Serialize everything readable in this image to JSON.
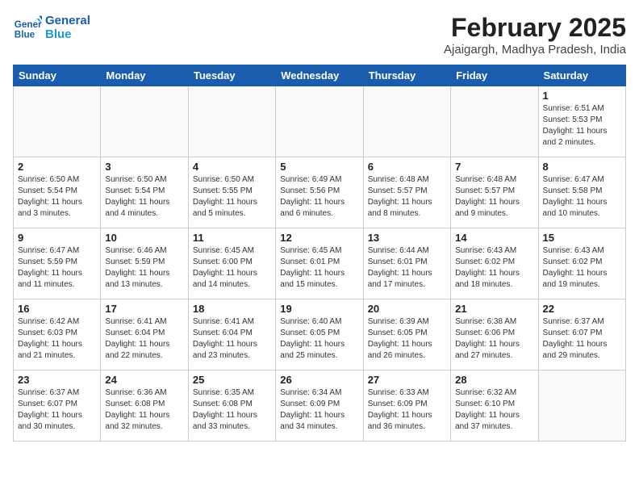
{
  "header": {
    "logo_line1": "General",
    "logo_line2": "Blue",
    "month": "February 2025",
    "location": "Ajaigargh, Madhya Pradesh, India"
  },
  "weekdays": [
    "Sunday",
    "Monday",
    "Tuesday",
    "Wednesday",
    "Thursday",
    "Friday",
    "Saturday"
  ],
  "weeks": [
    [
      {
        "day": "",
        "info": ""
      },
      {
        "day": "",
        "info": ""
      },
      {
        "day": "",
        "info": ""
      },
      {
        "day": "",
        "info": ""
      },
      {
        "day": "",
        "info": ""
      },
      {
        "day": "",
        "info": ""
      },
      {
        "day": "1",
        "info": "Sunrise: 6:51 AM\nSunset: 5:53 PM\nDaylight: 11 hours\nand 2 minutes."
      }
    ],
    [
      {
        "day": "2",
        "info": "Sunrise: 6:50 AM\nSunset: 5:54 PM\nDaylight: 11 hours\nand 3 minutes."
      },
      {
        "day": "3",
        "info": "Sunrise: 6:50 AM\nSunset: 5:54 PM\nDaylight: 11 hours\nand 4 minutes."
      },
      {
        "day": "4",
        "info": "Sunrise: 6:50 AM\nSunset: 5:55 PM\nDaylight: 11 hours\nand 5 minutes."
      },
      {
        "day": "5",
        "info": "Sunrise: 6:49 AM\nSunset: 5:56 PM\nDaylight: 11 hours\nand 6 minutes."
      },
      {
        "day": "6",
        "info": "Sunrise: 6:48 AM\nSunset: 5:57 PM\nDaylight: 11 hours\nand 8 minutes."
      },
      {
        "day": "7",
        "info": "Sunrise: 6:48 AM\nSunset: 5:57 PM\nDaylight: 11 hours\nand 9 minutes."
      },
      {
        "day": "8",
        "info": "Sunrise: 6:47 AM\nSunset: 5:58 PM\nDaylight: 11 hours\nand 10 minutes."
      }
    ],
    [
      {
        "day": "9",
        "info": "Sunrise: 6:47 AM\nSunset: 5:59 PM\nDaylight: 11 hours\nand 11 minutes."
      },
      {
        "day": "10",
        "info": "Sunrise: 6:46 AM\nSunset: 5:59 PM\nDaylight: 11 hours\nand 13 minutes."
      },
      {
        "day": "11",
        "info": "Sunrise: 6:45 AM\nSunset: 6:00 PM\nDaylight: 11 hours\nand 14 minutes."
      },
      {
        "day": "12",
        "info": "Sunrise: 6:45 AM\nSunset: 6:01 PM\nDaylight: 11 hours\nand 15 minutes."
      },
      {
        "day": "13",
        "info": "Sunrise: 6:44 AM\nSunset: 6:01 PM\nDaylight: 11 hours\nand 17 minutes."
      },
      {
        "day": "14",
        "info": "Sunrise: 6:43 AM\nSunset: 6:02 PM\nDaylight: 11 hours\nand 18 minutes."
      },
      {
        "day": "15",
        "info": "Sunrise: 6:43 AM\nSunset: 6:02 PM\nDaylight: 11 hours\nand 19 minutes."
      }
    ],
    [
      {
        "day": "16",
        "info": "Sunrise: 6:42 AM\nSunset: 6:03 PM\nDaylight: 11 hours\nand 21 minutes."
      },
      {
        "day": "17",
        "info": "Sunrise: 6:41 AM\nSunset: 6:04 PM\nDaylight: 11 hours\nand 22 minutes."
      },
      {
        "day": "18",
        "info": "Sunrise: 6:41 AM\nSunset: 6:04 PM\nDaylight: 11 hours\nand 23 minutes."
      },
      {
        "day": "19",
        "info": "Sunrise: 6:40 AM\nSunset: 6:05 PM\nDaylight: 11 hours\nand 25 minutes."
      },
      {
        "day": "20",
        "info": "Sunrise: 6:39 AM\nSunset: 6:05 PM\nDaylight: 11 hours\nand 26 minutes."
      },
      {
        "day": "21",
        "info": "Sunrise: 6:38 AM\nSunset: 6:06 PM\nDaylight: 11 hours\nand 27 minutes."
      },
      {
        "day": "22",
        "info": "Sunrise: 6:37 AM\nSunset: 6:07 PM\nDaylight: 11 hours\nand 29 minutes."
      }
    ],
    [
      {
        "day": "23",
        "info": "Sunrise: 6:37 AM\nSunset: 6:07 PM\nDaylight: 11 hours\nand 30 minutes."
      },
      {
        "day": "24",
        "info": "Sunrise: 6:36 AM\nSunset: 6:08 PM\nDaylight: 11 hours\nand 32 minutes."
      },
      {
        "day": "25",
        "info": "Sunrise: 6:35 AM\nSunset: 6:08 PM\nDaylight: 11 hours\nand 33 minutes."
      },
      {
        "day": "26",
        "info": "Sunrise: 6:34 AM\nSunset: 6:09 PM\nDaylight: 11 hours\nand 34 minutes."
      },
      {
        "day": "27",
        "info": "Sunrise: 6:33 AM\nSunset: 6:09 PM\nDaylight: 11 hours\nand 36 minutes."
      },
      {
        "day": "28",
        "info": "Sunrise: 6:32 AM\nSunset: 6:10 PM\nDaylight: 11 hours\nand 37 minutes."
      },
      {
        "day": "",
        "info": ""
      }
    ]
  ]
}
